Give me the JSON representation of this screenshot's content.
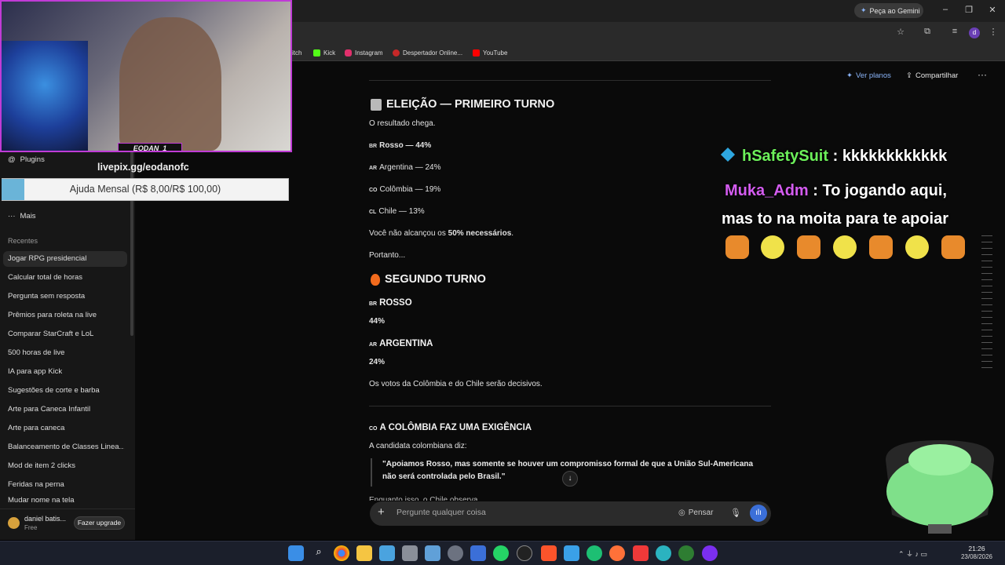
{
  "browser": {
    "gemini_button": "Peça ao Gemini",
    "bookmarks": [
      {
        "label": "itch",
        "icon": "twitch-icon"
      },
      {
        "label": "Kick",
        "icon": "kick-icon",
        "color": "#53fc18"
      },
      {
        "label": "Instagram",
        "icon": "instagram-icon",
        "color": "#e1306c"
      },
      {
        "label": "Despertador Online...",
        "icon": "clock-icon",
        "color": "#c62828"
      },
      {
        "label": "YouTube",
        "icon": "youtube-icon",
        "color": "#ff0000"
      }
    ],
    "profile_initial": "d"
  },
  "overlay": {
    "streamer_tag": "EODAN_1",
    "livepix": "livepix.gg/eodanofc",
    "donation_goal": "Ajuda Mensal (R$ 8,00/R$ 100,00)",
    "donation_progress": 0.08,
    "chat": [
      {
        "user": "hSafetySuit",
        "sep": " : ",
        "message": "kkkkkkkkkkkk",
        "user_color": "#6cf05a"
      },
      {
        "user": "Muka_Adm",
        "sep": " : ",
        "message": "To jogando aqui,",
        "message2": "mas to na moita para te apoiar",
        "user_color": "#d45cf0"
      }
    ]
  },
  "sidebar": {
    "plugins": "Plugins",
    "mais": "Mais",
    "section_recentes": "Recentes",
    "recent_items": [
      "Jogar RPG presidencial",
      "Calcular total de horas",
      "Pergunta sem resposta",
      "Prêmios para roleta na live",
      "Comparar StarCraft e LoL",
      "500 horas de live",
      "IA para app Kick",
      "Sugestões de corte e barba",
      "Arte para Caneca Infantil",
      "Arte para caneca",
      "Balanceamento de Classes Linea...",
      "Mod de item 2 clicks",
      "Feridas na perna",
      "Mudar nome na tela"
    ],
    "user_name": "daniel batis...",
    "user_plan": "Free",
    "upgrade_label": "Fazer upgrade"
  },
  "header": {
    "ver_planos": "Ver planos",
    "compartilhar": "Compartilhar"
  },
  "content": {
    "h_eleicao": "ELEIÇÃO — PRIMEIRO TURNO",
    "resultado": "O resultado chega.",
    "results": [
      {
        "flag": "BR",
        "text": "Rosso — 44%",
        "bold": true
      },
      {
        "flag": "AR",
        "text": "Argentina — 24%",
        "bold": false
      },
      {
        "flag": "CO",
        "text": "Colômbia — 19%",
        "bold": false
      },
      {
        "flag": "CL",
        "text": "Chile — 13%",
        "bold": false
      }
    ],
    "nao_alcancou_pre": "Você não alcançou os ",
    "nao_alcancou_bold": "50% necessários",
    "nao_alcancou_post": ".",
    "portanto": "Portanto...",
    "h_segundo": "SEGUNDO TURNO",
    "rosso_flag": "BR",
    "rosso": "ROSSO",
    "rosso_pct": "44%",
    "argentina_flag": "AR",
    "argentina": "ARGENTINA",
    "argentina_pct": "24%",
    "votos": "Os votos da Colômbia e do Chile serão decisivos.",
    "colombia_flag": "CO",
    "h_colombia": "A COLÔMBIA FAZ UMA EXIGÊNCIA",
    "candidata": "A candidata colombiana diz:",
    "quote": "\"Apoiamos Rosso, mas somente se houver um compromisso formal de que a União Sul-Americana não será controlada pelo Brasil.\"",
    "cut_line": "Enquanto isso, o Chile observa..."
  },
  "composer": {
    "placeholder": "Pergunte qualquer coisa",
    "pensar": "Pensar"
  },
  "taskbar": {
    "time": "21:26",
    "date": "23/08/2026"
  }
}
